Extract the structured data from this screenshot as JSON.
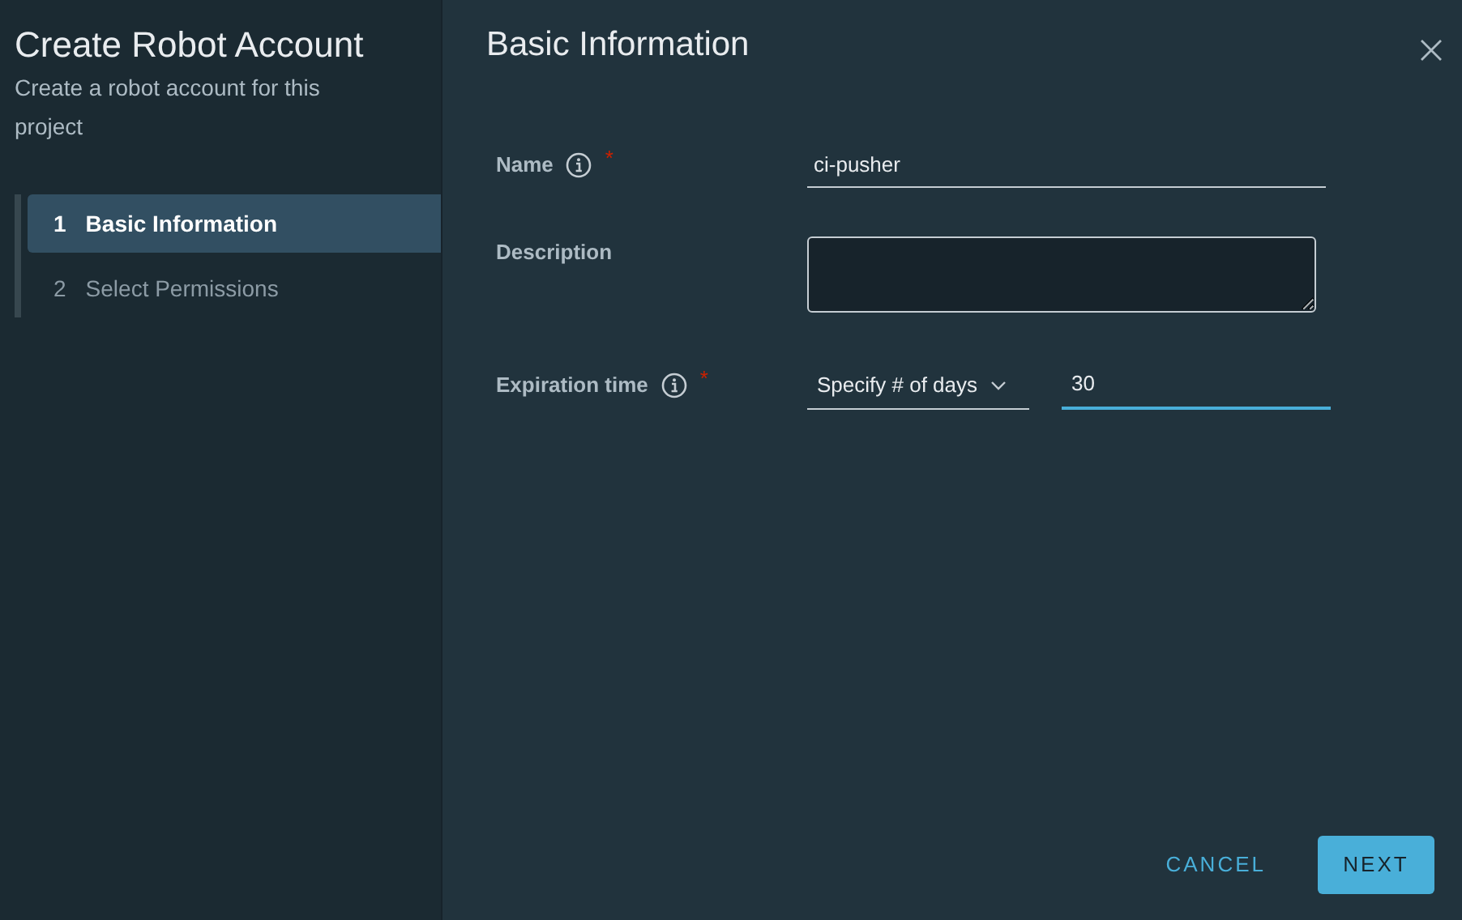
{
  "sidebar": {
    "title": "Create Robot Account",
    "subtitle": "Create a robot account for this project",
    "steps": [
      {
        "number": "1",
        "label": "Basic Information",
        "selected": true
      },
      {
        "number": "2",
        "label": "Select Permissions",
        "selected": false
      }
    ]
  },
  "content": {
    "title": "Basic Information",
    "fields": [
      {
        "kind": "text",
        "label": "Name",
        "info": true,
        "required_mark": "*",
        "value": "ci-pusher"
      },
      {
        "kind": "textarea",
        "label": "Description",
        "info": false
      },
      {
        "kind": "select-number",
        "label": "Expiration time",
        "info": true,
        "required_mark": "*",
        "select_value": "Specify # of days",
        "value": "30",
        "focused": true
      }
    ]
  },
  "buttons": [
    {
      "kind": "flat",
      "label": "CANCEL"
    },
    {
      "kind": "primary",
      "label": "NEXT"
    }
  ]
}
